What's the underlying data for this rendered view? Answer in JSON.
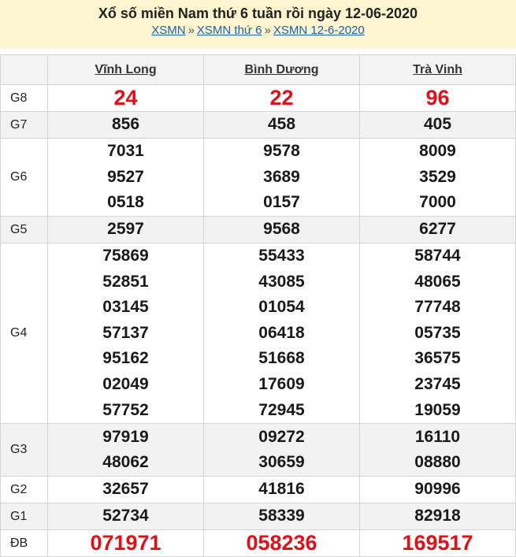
{
  "header": {
    "title": "Xổ số miền Nam thứ 6 tuần rồi ngày 12-06-2020",
    "breadcrumb": [
      {
        "label": "XSMN"
      },
      {
        "label": "XSMN thứ 6"
      },
      {
        "label": "XSMN 12-6-2020"
      }
    ],
    "separator": "»"
  },
  "columns": [
    "Vĩnh Long",
    "Bình Dương",
    "Trà Vinh"
  ],
  "rows": [
    {
      "label": "G8",
      "values": [
        [
          "24"
        ],
        [
          "22"
        ],
        [
          "96"
        ]
      ]
    },
    {
      "label": "G7",
      "values": [
        [
          "856"
        ],
        [
          "458"
        ],
        [
          "405"
        ]
      ]
    },
    {
      "label": "G6",
      "values": [
        [
          "7031",
          "9527",
          "0518"
        ],
        [
          "9578",
          "3689",
          "0157"
        ],
        [
          "8009",
          "3529",
          "7000"
        ]
      ]
    },
    {
      "label": "G5",
      "values": [
        [
          "2597"
        ],
        [
          "9568"
        ],
        [
          "6277"
        ]
      ]
    },
    {
      "label": "G4",
      "values": [
        [
          "75869",
          "52851",
          "03145",
          "57137",
          "95162",
          "02049",
          "57752"
        ],
        [
          "55433",
          "43085",
          "01054",
          "06418",
          "51668",
          "17609",
          "72945"
        ],
        [
          "58744",
          "48065",
          "77748",
          "05735",
          "36575",
          "23745",
          "19059"
        ]
      ]
    },
    {
      "label": "G3",
      "values": [
        [
          "97919",
          "48062"
        ],
        [
          "09272",
          "30659"
        ],
        [
          "16110",
          "08880"
        ]
      ]
    },
    {
      "label": "G2",
      "values": [
        [
          "32657"
        ],
        [
          "41816"
        ],
        [
          "90996"
        ]
      ]
    },
    {
      "label": "G1",
      "values": [
        [
          "52734"
        ],
        [
          "58339"
        ],
        [
          "82918"
        ]
      ]
    },
    {
      "label": "ĐB",
      "values": [
        [
          "071971"
        ],
        [
          "058236"
        ],
        [
          "169517"
        ]
      ]
    }
  ],
  "colors": {
    "special": "#e0101a",
    "link": "#1f5fb0",
    "header_bg": "#fdf5cf"
  }
}
